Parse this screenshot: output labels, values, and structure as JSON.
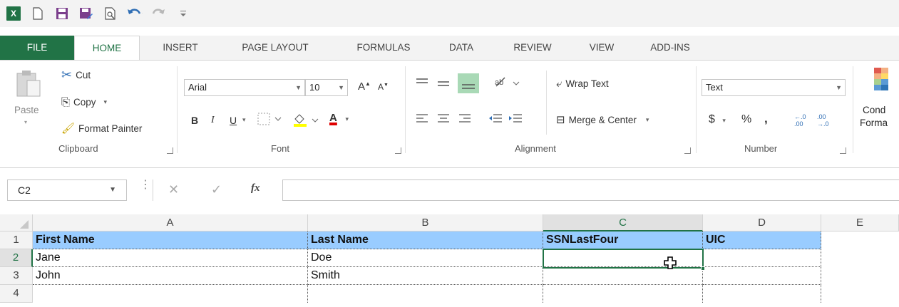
{
  "quick_access": {
    "icons": [
      "excel-logo-icon",
      "new-file-icon",
      "save-icon",
      "save-as-icon",
      "print-preview-icon",
      "undo-icon",
      "redo-icon",
      "customize-qat-icon"
    ],
    "excel_logo_text": "X"
  },
  "tabs": [
    "FILE",
    "HOME",
    "INSERT",
    "PAGE LAYOUT",
    "FORMULAS",
    "DATA",
    "REVIEW",
    "VIEW",
    "ADD-INS"
  ],
  "active_tab": "HOME",
  "ribbon": {
    "clipboard": {
      "label": "Clipboard",
      "paste": "Paste",
      "cut": "Cut",
      "copy": "Copy",
      "format_painter": "Format Painter"
    },
    "font": {
      "label": "Font",
      "font_name": "Arial",
      "font_size": "10",
      "bold": "B",
      "italic": "I",
      "underline": "U",
      "increase_size": "A",
      "decrease_size": "A",
      "font_color": "A",
      "font_color_hex": "#e00000",
      "fill_color_hex": "#ffff00"
    },
    "alignment": {
      "label": "Alignment",
      "wrap_text": "Wrap Text",
      "merge_center": "Merge & Center"
    },
    "number": {
      "label": "Number",
      "format": "Text",
      "currency": "$",
      "percent": "%",
      "comma": ",",
      "increase_decimal": "←.0 .00",
      "decrease_decimal": ".00 →.0"
    },
    "styles": {
      "cond_format_line1": "Cond",
      "cond_format_line2": "Forma"
    }
  },
  "formula_bar": {
    "name_box": "C2",
    "cancel": "✕",
    "enter": "✓",
    "fx": "fx",
    "value": ""
  },
  "sheet": {
    "columns": [
      "A",
      "B",
      "C",
      "D",
      "E"
    ],
    "rows": [
      "1",
      "2",
      "3",
      "4"
    ],
    "cells": [
      [
        "First Name",
        "Last Name",
        "SSNLastFour",
        "UIC"
      ],
      [
        "Jane",
        "Doe",
        "",
        ""
      ],
      [
        "John",
        "Smith",
        "",
        ""
      ],
      [
        "",
        "",
        "",
        ""
      ]
    ],
    "selected_cell": "C2",
    "header_fill": "#99ccff",
    "accent": "#217346"
  }
}
